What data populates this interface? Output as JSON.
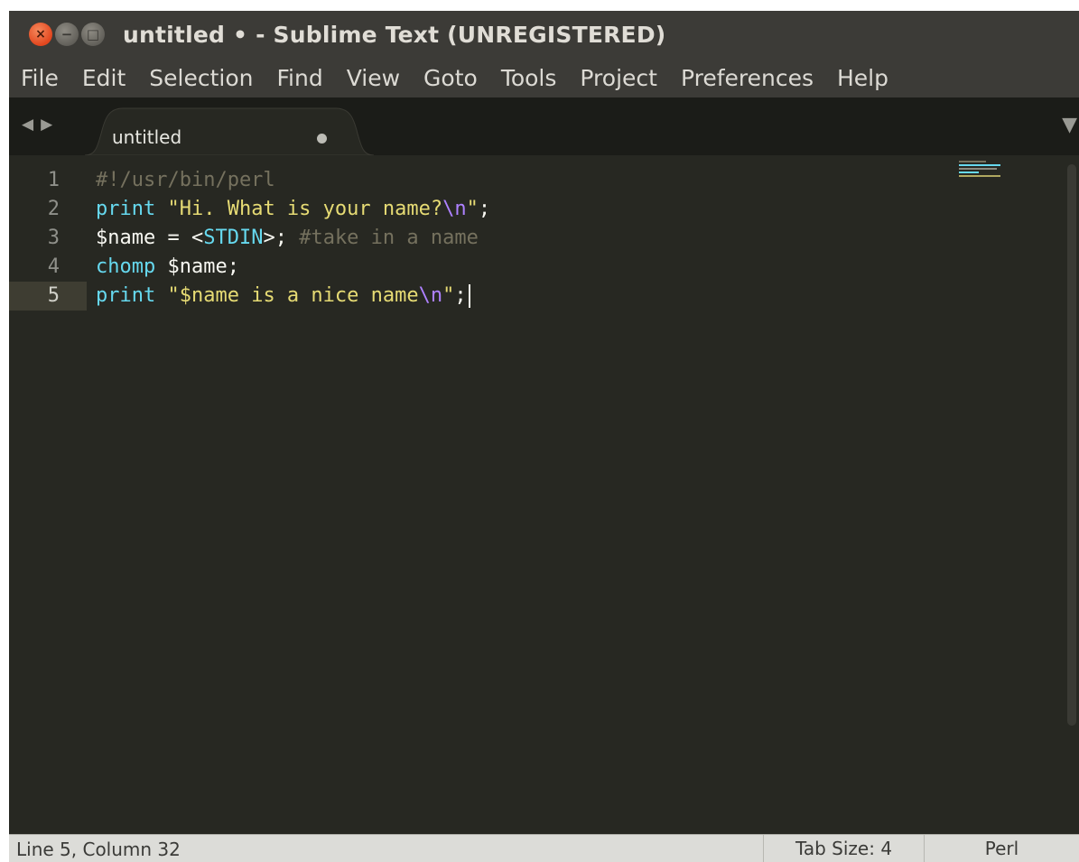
{
  "window": {
    "title": "untitled • - Sublime Text (UNREGISTERED)",
    "buttons": {
      "close_glyph": "×",
      "minimize_glyph": "−",
      "maximize_glyph": "□"
    }
  },
  "menu": {
    "items": [
      "File",
      "Edit",
      "Selection",
      "Find",
      "View",
      "Goto",
      "Tools",
      "Project",
      "Preferences",
      "Help"
    ]
  },
  "tabs": {
    "nav_prev_icon": "◀",
    "nav_next_icon": "▶",
    "active": {
      "label": "untitled",
      "dirty": true
    },
    "dropdown_icon": "▼"
  },
  "editor": {
    "line_numbers": [
      "1",
      "2",
      "3",
      "4",
      "5"
    ],
    "current_line": "5",
    "lines": [
      [
        {
          "cls": "tk-comment",
          "text": "#!/usr/bin/perl"
        }
      ],
      [
        {
          "cls": "tk-keyword",
          "text": "print"
        },
        {
          "cls": "tk-plain",
          "text": " "
        },
        {
          "cls": "tk-string",
          "text": "\"Hi. What is your name?"
        },
        {
          "cls": "tk-escape",
          "text": "\\n"
        },
        {
          "cls": "tk-string",
          "text": "\""
        },
        {
          "cls": "tk-plain",
          "text": ";"
        }
      ],
      [
        {
          "cls": "tk-plain",
          "text": "$name = <"
        },
        {
          "cls": "tk-keyword",
          "text": "STDIN"
        },
        {
          "cls": "tk-plain",
          "text": ">; "
        },
        {
          "cls": "tk-comment",
          "text": "#take in a name"
        }
      ],
      [
        {
          "cls": "tk-keyword",
          "text": "chomp"
        },
        {
          "cls": "tk-plain",
          "text": " $name;"
        }
      ],
      [
        {
          "cls": "tk-keyword",
          "text": "print"
        },
        {
          "cls": "tk-plain",
          "text": " "
        },
        {
          "cls": "tk-string",
          "text": "\"$name is a nice name"
        },
        {
          "cls": "tk-escape",
          "text": "\\n"
        },
        {
          "cls": "tk-string",
          "text": "\""
        },
        {
          "cls": "tk-plain",
          "text": ";"
        }
      ]
    ]
  },
  "colors": {
    "background": "#272822",
    "keyword": "#66d9ef",
    "string": "#e6db74",
    "escape": "#ae81ff",
    "comment": "#75715e",
    "close_button": "#e2461e"
  },
  "status": {
    "position": "Line 5, Column 32",
    "tab_size": "Tab Size: 4",
    "syntax": "Perl"
  }
}
